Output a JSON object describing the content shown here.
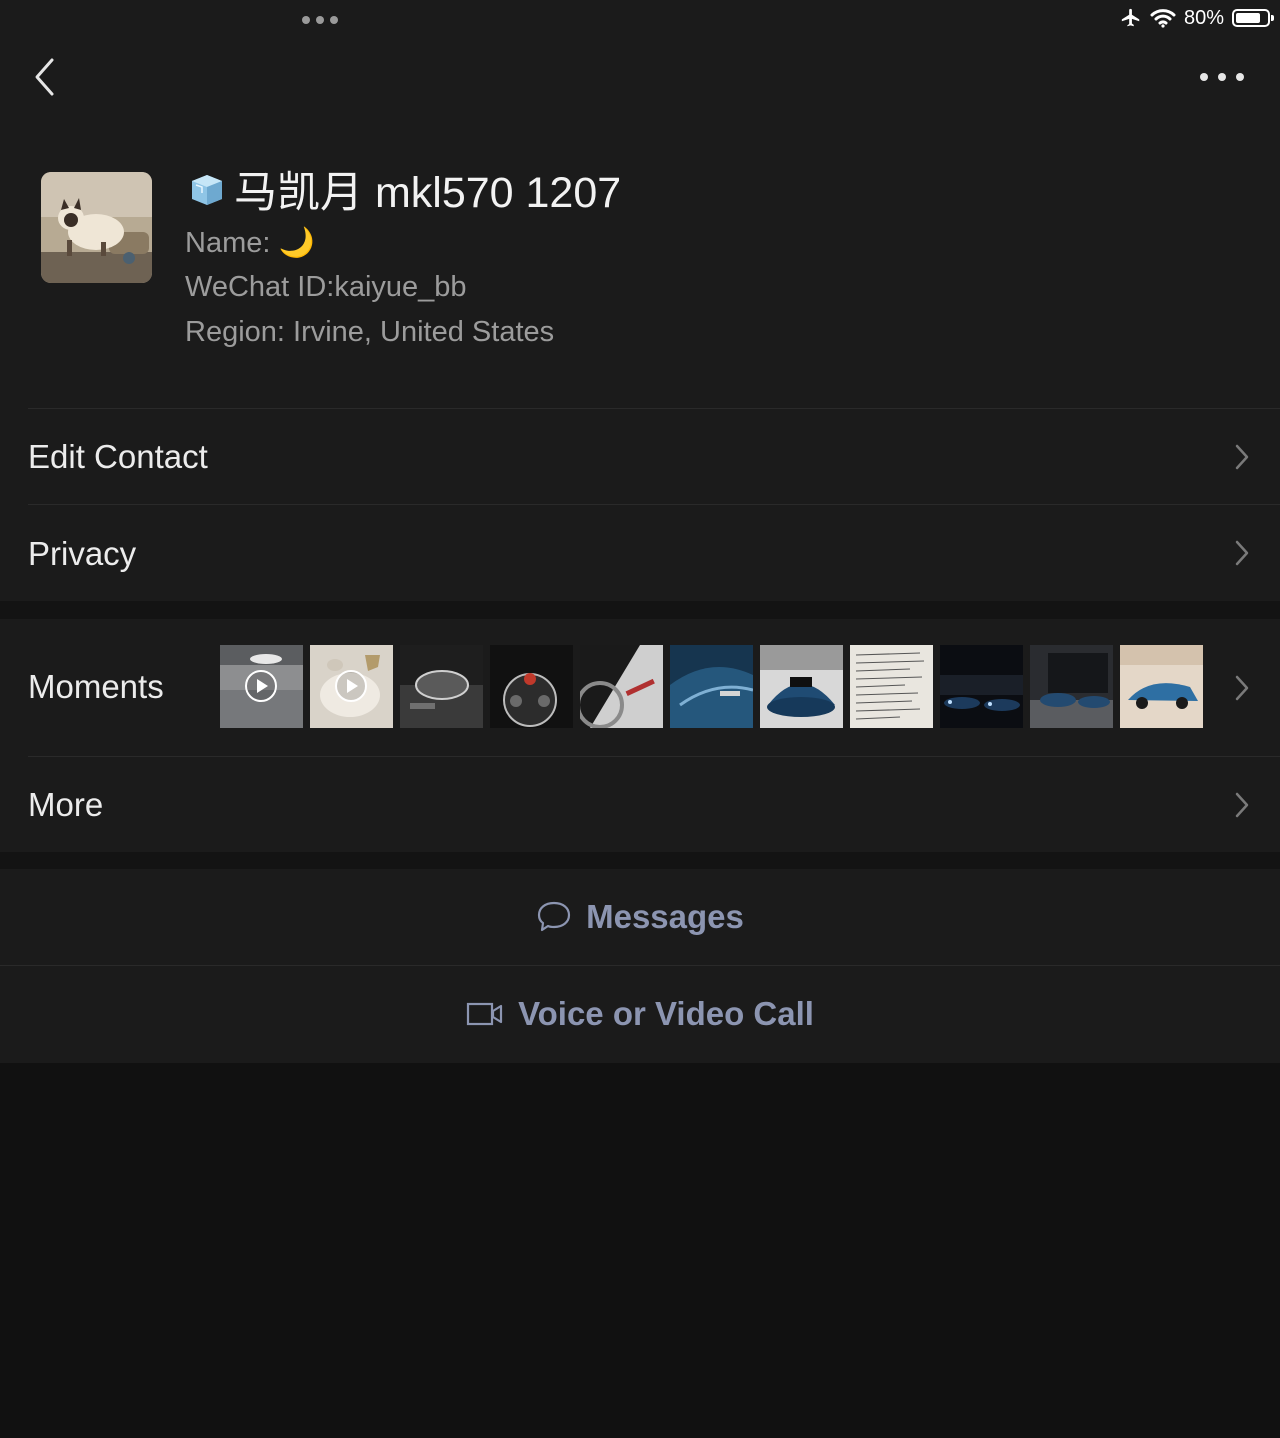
{
  "status_bar": {
    "battery_text": "80%",
    "battery_level": 0.8,
    "icons": [
      "airplane-icon",
      "wifi-icon",
      "battery-icon"
    ]
  },
  "nav": {
    "back_icon": "chevron-left-icon",
    "more_icon": "ellipsis-icon"
  },
  "profile": {
    "display_name": "马凯月 mkl570 1207",
    "name_line": "Name: 🌙",
    "wechat_id_line": "WeChat ID:kaiyue_bb",
    "region_line": "Region: Irvine, United States"
  },
  "menu": {
    "edit_contact": "Edit Contact",
    "privacy": "Privacy",
    "moments": "Moments",
    "more": "More"
  },
  "actions": {
    "messages": "Messages",
    "call": "Voice or Video Call"
  },
  "colors": {
    "background": "#111111",
    "panel": "#1b1b1b",
    "primary_text": "#ececec",
    "secondary_text": "#9c9c9c",
    "action_text": "#8c95b1"
  }
}
